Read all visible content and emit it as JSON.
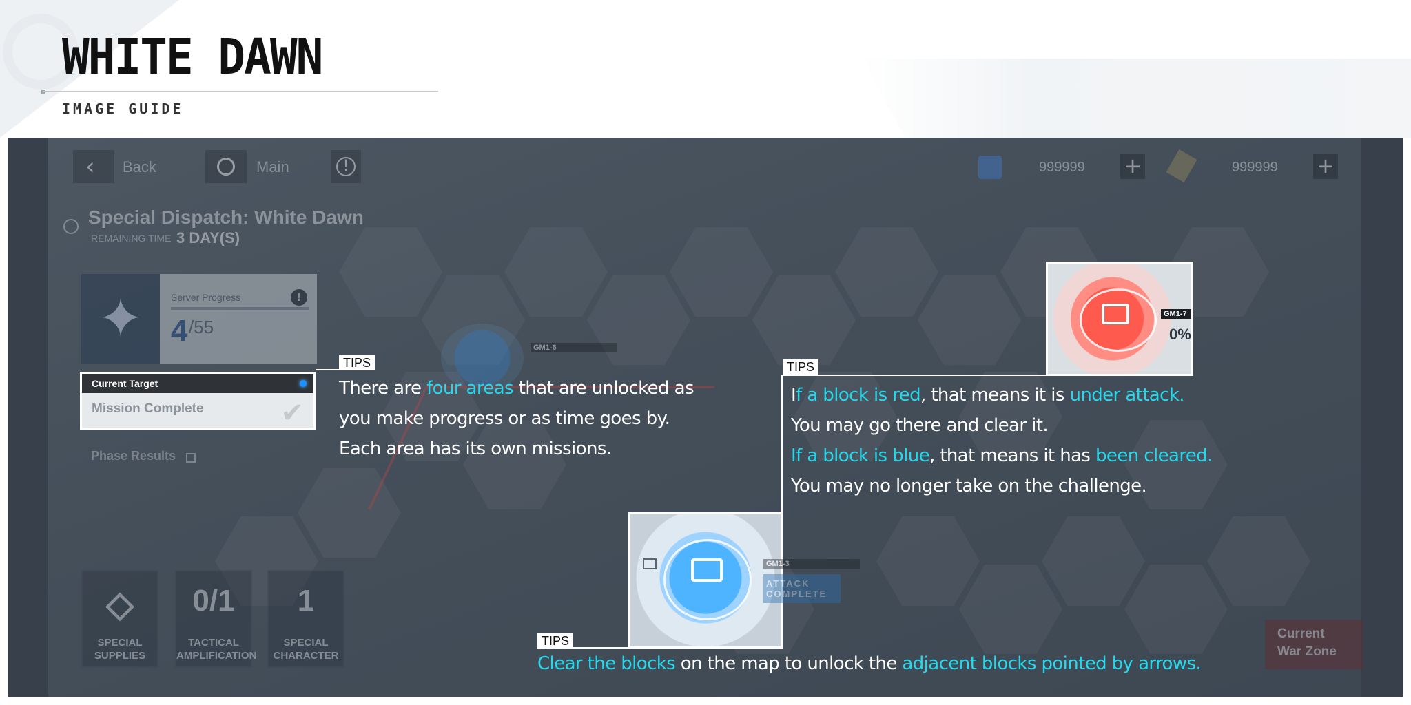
{
  "header": {
    "title": "WHITE DAWN",
    "subtitle": "IMAGE GUIDE"
  },
  "game_ui": {
    "back_label": "Back",
    "main_label": "Main",
    "resource1_value": "999999",
    "resource2_value": "999999",
    "dispatch_title": "Special Dispatch: White Dawn",
    "remaining_label": "REMAINING TIME",
    "remaining_value": "3 DAY(S)",
    "server_progress_label": "Server Progress",
    "server_progress_value": "4",
    "server_progress_total": "/55",
    "current_target_label": "Current Target",
    "current_target_value": "Mission Complete",
    "phase_results_label": "Phase Results",
    "bottom_cards": [
      {
        "big": "",
        "label_line1": "SPECIAL",
        "label_line2": "SUPPLIES"
      },
      {
        "big": "0/1",
        "label_line1": "TACTICAL",
        "label_line2": "AMPLIFICATION"
      },
      {
        "big": "1",
        "label_line1": "SPECIAL",
        "label_line2": "CHARACTER"
      }
    ],
    "warzone_line1": "Current",
    "warzone_line2": "War Zone",
    "tag_red": "GM1-7",
    "tag_red_progress": "0%",
    "tag_blue": "GM1-3",
    "tag_blue_status": "ATTACK COMPLETE",
    "tag_mid": "GM1-6"
  },
  "tips": {
    "label": "TIPS",
    "tip1": {
      "l1a": "There are ",
      "l1b": "four areas",
      "l1c": " that are unlocked as",
      "l2": "you make progress or as time goes by.",
      "l3": "Each area has its own missions."
    },
    "tip2": {
      "l1a": "I",
      "l1b": "f a block is red",
      "l1c": ", that means it is ",
      "l1d": "under attack.",
      "l2": "You may go there and clear it.",
      "l3a": "If a block is blue",
      "l3b": ", that means it has ",
      "l3c": "been cleared.",
      "l4": "You may no longer take on the challenge."
    },
    "tip3": {
      "a": "Clear the blocks",
      "b": " on the map to unlock the ",
      "c": "adjacent blocks pointed by arrows."
    }
  },
  "colors": {
    "highlight": "#25d8ec",
    "panel": "#3b4450"
  }
}
